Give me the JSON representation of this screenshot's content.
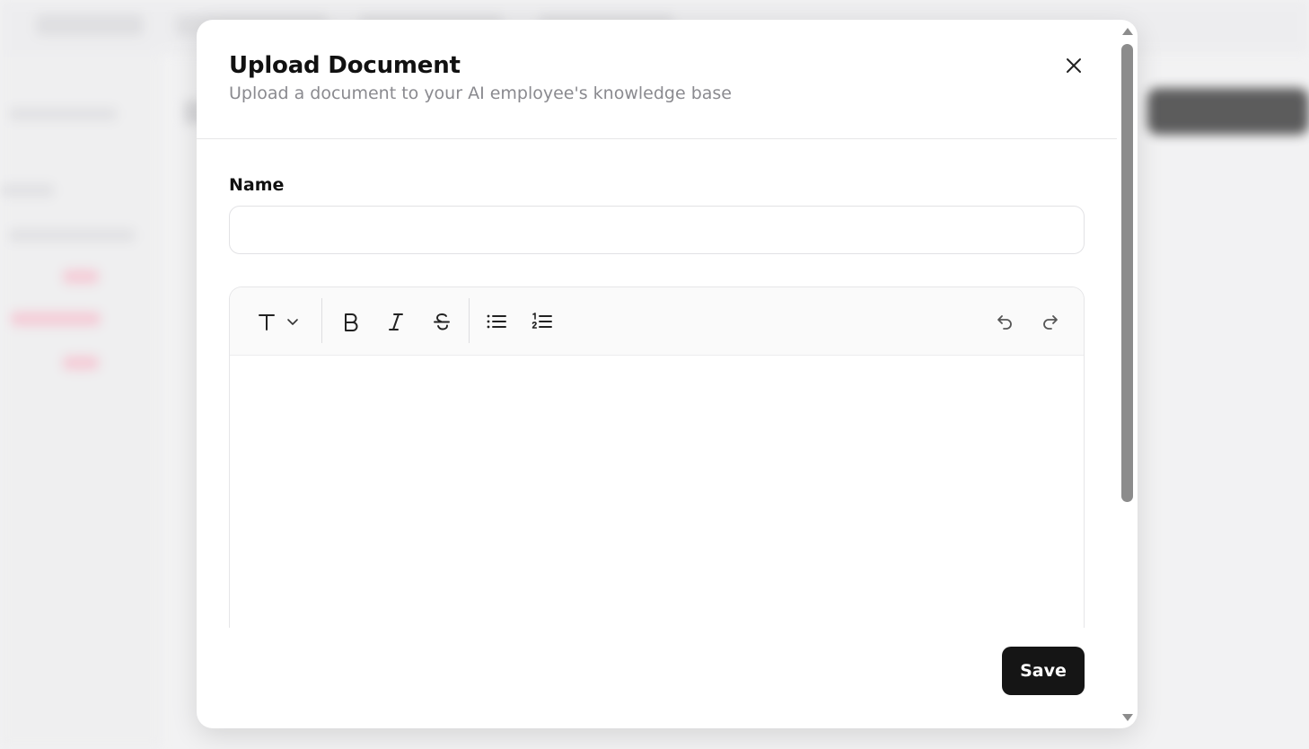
{
  "modal": {
    "title": "Upload Document",
    "subtitle": "Upload a document to your AI employee's knowledge base",
    "close_icon": "close-icon"
  },
  "form": {
    "name_label": "Name",
    "name_value": "",
    "name_placeholder": ""
  },
  "editor": {
    "toolbar": [
      {
        "name": "text-style",
        "icon": "text-type-icon"
      },
      {
        "name": "bold",
        "icon": "bold-icon"
      },
      {
        "name": "italic",
        "icon": "italic-icon"
      },
      {
        "name": "strikethrough",
        "icon": "strikethrough-icon"
      },
      {
        "name": "bullet-list",
        "icon": "bullet-list-icon"
      },
      {
        "name": "ordered-list",
        "icon": "ordered-list-icon"
      },
      {
        "name": "undo",
        "icon": "undo-icon"
      },
      {
        "name": "redo",
        "icon": "redo-icon"
      }
    ],
    "content": ""
  },
  "actions": {
    "save_label": "Save"
  },
  "colors": {
    "primary_button": "#151515",
    "subtitle_text": "#8a8a8f",
    "border": "#e2e2e5",
    "toolbar_bg": "#fafafa"
  }
}
